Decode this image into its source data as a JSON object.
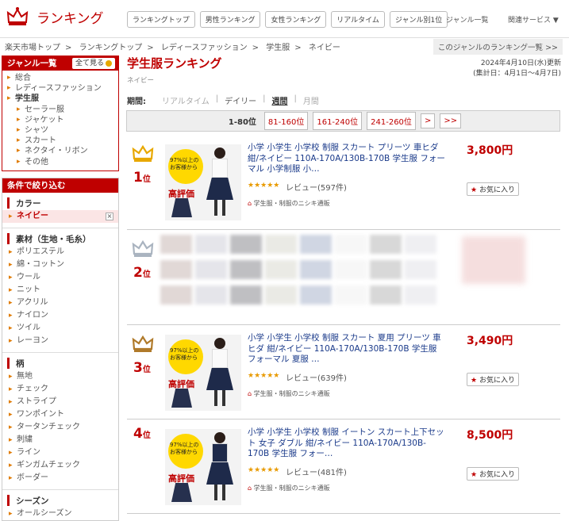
{
  "header": {
    "logo_text": "ランキング",
    "nav": [
      "ランキングトップ",
      "男性ランキング",
      "女性ランキング",
      "リアルタイム",
      "ジャンル別1位"
    ],
    "link_genre_list": "ジャンル一覧",
    "link_services": "関連サービス ▼"
  },
  "breadcrumb": {
    "items": [
      "楽天市場トップ",
      "ランキングトップ",
      "レディースファッション",
      "学生服",
      "ネイビー"
    ],
    "sep": ">",
    "genre_list_btn": "このジャンルのランキング一覧 >>"
  },
  "sidebar": {
    "genre_title": "ジャンル一覧",
    "all_btn": "全て見る",
    "genres": [
      {
        "label": "総合",
        "sel": false,
        "sub": false
      },
      {
        "label": "レディースファッション",
        "sel": false,
        "sub": false
      },
      {
        "label": "学生服",
        "sel": true,
        "sub": false
      },
      {
        "label": "セーラー服",
        "sel": false,
        "sub": true
      },
      {
        "label": "ジャケット",
        "sel": false,
        "sub": true
      },
      {
        "label": "シャツ",
        "sel": false,
        "sub": true
      },
      {
        "label": "スカート",
        "sel": false,
        "sub": true
      },
      {
        "label": "ネクタイ・リボン",
        "sel": false,
        "sub": true
      },
      {
        "label": "その他",
        "sel": false,
        "sub": true
      }
    ],
    "filter_title": "条件で絞り込む",
    "color_title": "カラー",
    "color_active": "ネイビー",
    "material_title": "素材（生地・毛糸）",
    "materials": [
      "ポリエステル",
      "綿・コットン",
      "ウール",
      "ニット",
      "アクリル",
      "ナイロン",
      "ツイル",
      "レーヨン"
    ],
    "pattern_title": "柄",
    "patterns": [
      "無地",
      "チェック",
      "ストライプ",
      "ワンポイント",
      "タータンチェック",
      "刺繍",
      "ライン",
      "ギンガムチェック",
      "ボーダー"
    ],
    "season_title": "シーズン",
    "seasons": [
      "オールシーズン"
    ]
  },
  "main": {
    "title": "学生服ランキング",
    "subtitle": "ネイビー",
    "updated": "2024年4月10日(水)更新",
    "period_range": "(集計日：4月1日〜4月7日)",
    "period_label": "期間:",
    "periods": [
      "リアルタイム",
      "デイリー",
      "週間",
      "月間"
    ],
    "period_sep": "|",
    "pager": [
      "1-80位",
      "81-160位",
      "161-240位",
      "241-260位",
      ">",
      ">>"
    ]
  },
  "items": [
    {
      "rank": "1",
      "rank_suffix": "位",
      "title": "小学 小学生 小学校 制服 スカート プリーツ 車ヒダ 紺/ネイビー 110A-170A/130B-170B 学生服 フォーマル 小学制服 小…",
      "price": "3,800円",
      "stars": "★★★★★",
      "review": "レビュー(597件)",
      "shop": "学生服・制服のニシキ通販",
      "fav": "お気に入り",
      "crown": "gold"
    },
    {
      "rank": "2",
      "rank_suffix": "位",
      "title": "",
      "price": "",
      "stars": "",
      "review": "",
      "shop": "",
      "fav": "",
      "crown": "silver"
    },
    {
      "rank": "3",
      "rank_suffix": "位",
      "title": "小学 小学生 小学校 制服 スカート 夏用 プリーツ 車ヒダ 紺/ネイビー 110A-170A/130B-170B 学生服 フォーマル 夏服 …",
      "price": "3,490円",
      "stars": "★★★★★",
      "review": "レビュー(639件)",
      "shop": "学生服・制服のニシキ通販",
      "fav": "お気に入り",
      "crown": "bronze"
    },
    {
      "rank": "4",
      "rank_suffix": "位",
      "title": "小学 小学生 小学校 制服 イートン スカート上下セット 女子 ダブル 紺/ネイビー 110A-170A/130B-170B 学生服 フォー…",
      "price": "8,500円",
      "stars": "★★★★★",
      "review": "レビュー(481件)",
      "shop": "学生服・制服のニシキ通販",
      "fav": "お気に入り",
      "crown": "none"
    }
  ],
  "thumb_text": {
    "l1": "97%以上の",
    "l2": "お客様から",
    "l3": "高評価"
  },
  "colors": {
    "accent": "#bf0000",
    "link": "#1a3a8a",
    "gold": "#e8a800",
    "silver": "#aab4c0",
    "bronze": "#b07a2a"
  }
}
